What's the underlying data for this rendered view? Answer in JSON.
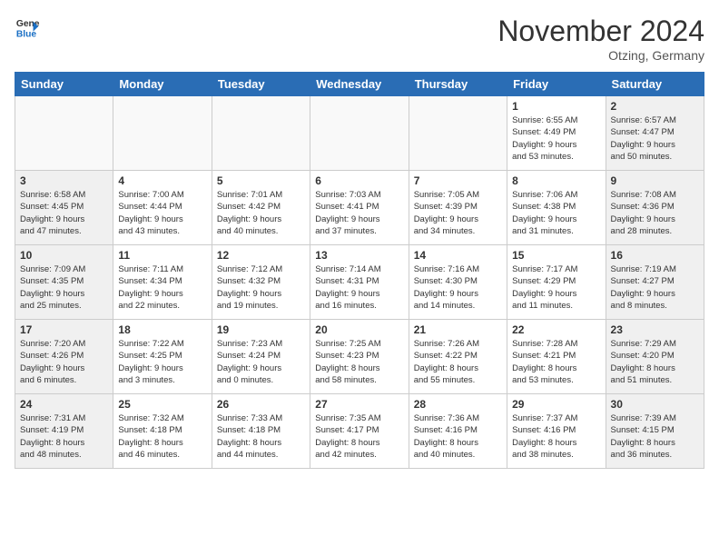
{
  "logo": {
    "line1": "General",
    "line2": "Blue"
  },
  "title": "November 2024",
  "subtitle": "Otzing, Germany",
  "days_of_week": [
    "Sunday",
    "Monday",
    "Tuesday",
    "Wednesday",
    "Thursday",
    "Friday",
    "Saturday"
  ],
  "weeks": [
    [
      {
        "day": "",
        "detail": ""
      },
      {
        "day": "",
        "detail": ""
      },
      {
        "day": "",
        "detail": ""
      },
      {
        "day": "",
        "detail": ""
      },
      {
        "day": "",
        "detail": ""
      },
      {
        "day": "1",
        "detail": "Sunrise: 6:55 AM\nSunset: 4:49 PM\nDaylight: 9 hours\nand 53 minutes."
      },
      {
        "day": "2",
        "detail": "Sunrise: 6:57 AM\nSunset: 4:47 PM\nDaylight: 9 hours\nand 50 minutes."
      }
    ],
    [
      {
        "day": "3",
        "detail": "Sunrise: 6:58 AM\nSunset: 4:45 PM\nDaylight: 9 hours\nand 47 minutes."
      },
      {
        "day": "4",
        "detail": "Sunrise: 7:00 AM\nSunset: 4:44 PM\nDaylight: 9 hours\nand 43 minutes."
      },
      {
        "day": "5",
        "detail": "Sunrise: 7:01 AM\nSunset: 4:42 PM\nDaylight: 9 hours\nand 40 minutes."
      },
      {
        "day": "6",
        "detail": "Sunrise: 7:03 AM\nSunset: 4:41 PM\nDaylight: 9 hours\nand 37 minutes."
      },
      {
        "day": "7",
        "detail": "Sunrise: 7:05 AM\nSunset: 4:39 PM\nDaylight: 9 hours\nand 34 minutes."
      },
      {
        "day": "8",
        "detail": "Sunrise: 7:06 AM\nSunset: 4:38 PM\nDaylight: 9 hours\nand 31 minutes."
      },
      {
        "day": "9",
        "detail": "Sunrise: 7:08 AM\nSunset: 4:36 PM\nDaylight: 9 hours\nand 28 minutes."
      }
    ],
    [
      {
        "day": "10",
        "detail": "Sunrise: 7:09 AM\nSunset: 4:35 PM\nDaylight: 9 hours\nand 25 minutes."
      },
      {
        "day": "11",
        "detail": "Sunrise: 7:11 AM\nSunset: 4:34 PM\nDaylight: 9 hours\nand 22 minutes."
      },
      {
        "day": "12",
        "detail": "Sunrise: 7:12 AM\nSunset: 4:32 PM\nDaylight: 9 hours\nand 19 minutes."
      },
      {
        "day": "13",
        "detail": "Sunrise: 7:14 AM\nSunset: 4:31 PM\nDaylight: 9 hours\nand 16 minutes."
      },
      {
        "day": "14",
        "detail": "Sunrise: 7:16 AM\nSunset: 4:30 PM\nDaylight: 9 hours\nand 14 minutes."
      },
      {
        "day": "15",
        "detail": "Sunrise: 7:17 AM\nSunset: 4:29 PM\nDaylight: 9 hours\nand 11 minutes."
      },
      {
        "day": "16",
        "detail": "Sunrise: 7:19 AM\nSunset: 4:27 PM\nDaylight: 9 hours\nand 8 minutes."
      }
    ],
    [
      {
        "day": "17",
        "detail": "Sunrise: 7:20 AM\nSunset: 4:26 PM\nDaylight: 9 hours\nand 6 minutes."
      },
      {
        "day": "18",
        "detail": "Sunrise: 7:22 AM\nSunset: 4:25 PM\nDaylight: 9 hours\nand 3 minutes."
      },
      {
        "day": "19",
        "detail": "Sunrise: 7:23 AM\nSunset: 4:24 PM\nDaylight: 9 hours\nand 0 minutes."
      },
      {
        "day": "20",
        "detail": "Sunrise: 7:25 AM\nSunset: 4:23 PM\nDaylight: 8 hours\nand 58 minutes."
      },
      {
        "day": "21",
        "detail": "Sunrise: 7:26 AM\nSunset: 4:22 PM\nDaylight: 8 hours\nand 55 minutes."
      },
      {
        "day": "22",
        "detail": "Sunrise: 7:28 AM\nSunset: 4:21 PM\nDaylight: 8 hours\nand 53 minutes."
      },
      {
        "day": "23",
        "detail": "Sunrise: 7:29 AM\nSunset: 4:20 PM\nDaylight: 8 hours\nand 51 minutes."
      }
    ],
    [
      {
        "day": "24",
        "detail": "Sunrise: 7:31 AM\nSunset: 4:19 PM\nDaylight: 8 hours\nand 48 minutes."
      },
      {
        "day": "25",
        "detail": "Sunrise: 7:32 AM\nSunset: 4:18 PM\nDaylight: 8 hours\nand 46 minutes."
      },
      {
        "day": "26",
        "detail": "Sunrise: 7:33 AM\nSunset: 4:18 PM\nDaylight: 8 hours\nand 44 minutes."
      },
      {
        "day": "27",
        "detail": "Sunrise: 7:35 AM\nSunset: 4:17 PM\nDaylight: 8 hours\nand 42 minutes."
      },
      {
        "day": "28",
        "detail": "Sunrise: 7:36 AM\nSunset: 4:16 PM\nDaylight: 8 hours\nand 40 minutes."
      },
      {
        "day": "29",
        "detail": "Sunrise: 7:37 AM\nSunset: 4:16 PM\nDaylight: 8 hours\nand 38 minutes."
      },
      {
        "day": "30",
        "detail": "Sunrise: 7:39 AM\nSunset: 4:15 PM\nDaylight: 8 hours\nand 36 minutes."
      }
    ]
  ]
}
